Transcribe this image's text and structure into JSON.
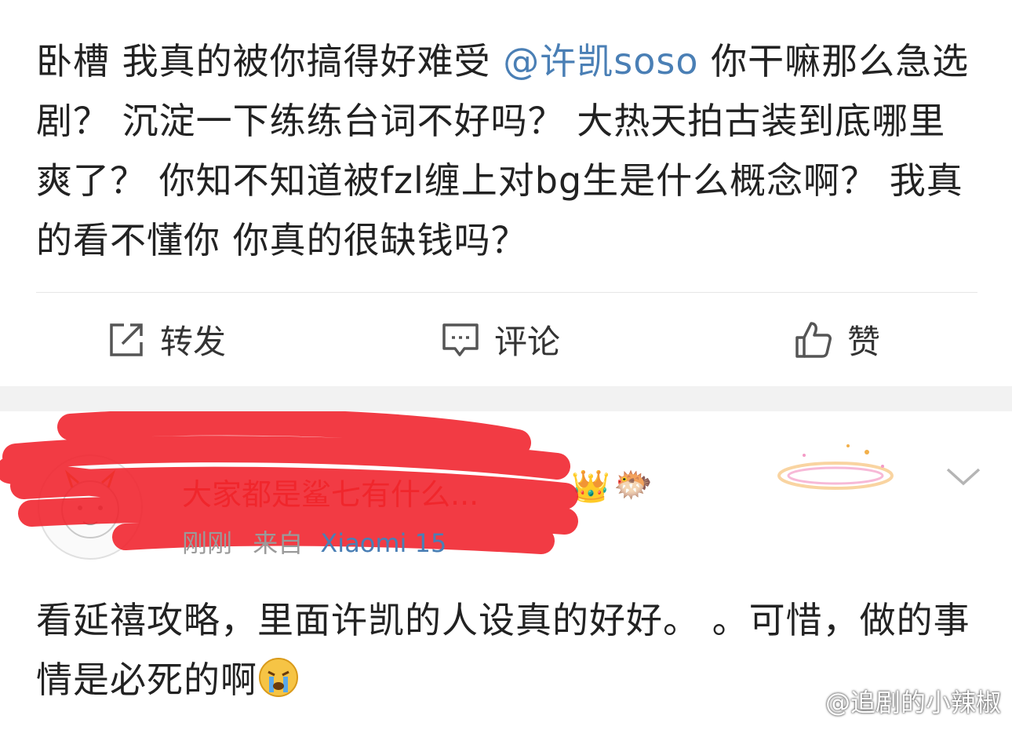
{
  "post": {
    "text_part1": "卧槽 我真的被你搞得好难受 ",
    "mention": "@许凯soso",
    "text_part2": " 你干嘛那么急选剧？ 沉淀一下练练台词不好吗？ 大热天拍古装到底哪里爽了？ 你知不知道被fzl缠上对bg生是什么概念啊？ 我真的看不懂你 你真的很缺钱吗？"
  },
  "actions": {
    "repost_label": "转发",
    "comment_label": "评论",
    "like_label": "赞"
  },
  "comment": {
    "username": "大家都是鲨七有什么...",
    "time": "刚刚",
    "from_prefix": "来自",
    "device": "Xiaomi 15",
    "text": "看延禧攻略，里面许凯的人设真的好好。 。可惜，做的事情是必死的啊",
    "badges": [
      "crown-badge-icon",
      "fish-badge-icon"
    ],
    "emoji": "crying-emoji-icon"
  },
  "watermark": "@追剧的小辣椒",
  "colors": {
    "mention": "#4a7fb5",
    "username": "#e8533b",
    "scribble": "#f0202a",
    "separator_band": "#f2f2f2"
  }
}
